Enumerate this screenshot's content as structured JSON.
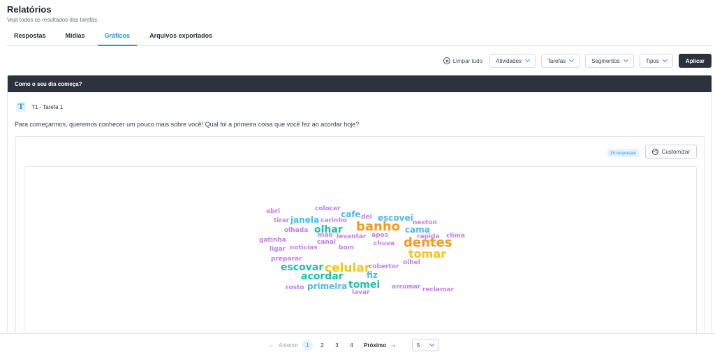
{
  "header": {
    "title": "Relatórios",
    "subtitle": "Veja todos os resultados das tarefas."
  },
  "tabs": [
    {
      "label": "Respostas",
      "active": false
    },
    {
      "label": "Mídias",
      "active": false
    },
    {
      "label": "Gráficos",
      "active": true
    },
    {
      "label": "Arquivos exportados",
      "active": false
    }
  ],
  "filters": {
    "clear_label": "Limpar tudo",
    "atividades": "Atividades",
    "tarefas": "Tarefas",
    "segmentos": "Segmentos",
    "tipos": "Tipos",
    "apply_label": "Aplicar"
  },
  "card": {
    "title": "Como o seu dia começa?",
    "task_icon_letter": "T",
    "task_label": "T1 - Tarefa 1",
    "question": "Para começarmos, queremos conhecer um pouco mais sobre você! Qual foi a primeira coisa que você fez ao acordar hoje?",
    "responses_badge": "15 respostas",
    "customize_label": "Customizar"
  },
  "colors": {
    "accent": "#1e96e9",
    "dark": "#2c313b",
    "purple": "#c27ef0",
    "blue": "#4fb8ef",
    "teal": "#16c4a6",
    "orange": "#f49b1c",
    "yellow": "#f7c321"
  },
  "wordcloud": {
    "words": [
      {
        "text": "abri",
        "color": "purple"
      },
      {
        "text": "colocar",
        "color": "purple"
      },
      {
        "text": "cafe",
        "color": "blue"
      },
      {
        "text": "tirar",
        "color": "purple"
      },
      {
        "text": "janela",
        "color": "blue"
      },
      {
        "text": "carinho",
        "color": "purple"
      },
      {
        "text": "dei",
        "color": "purple"
      },
      {
        "text": "escovei",
        "color": "blue"
      },
      {
        "text": "neston",
        "color": "purple"
      },
      {
        "text": "olhada",
        "color": "purple"
      },
      {
        "text": "olhar",
        "color": "teal"
      },
      {
        "text": "banho",
        "color": "orange"
      },
      {
        "text": "cama",
        "color": "blue"
      },
      {
        "text": "mae",
        "color": "purple"
      },
      {
        "text": "levantar",
        "color": "purple"
      },
      {
        "text": "apos",
        "color": "purple"
      },
      {
        "text": "rapida",
        "color": "purple"
      },
      {
        "text": "clima",
        "color": "purple"
      },
      {
        "text": "gatinha",
        "color": "purple"
      },
      {
        "text": "canal",
        "color": "purple"
      },
      {
        "text": "chuva",
        "color": "purple"
      },
      {
        "text": "dentes",
        "color": "orange"
      },
      {
        "text": "ligar",
        "color": "purple"
      },
      {
        "text": "noticias",
        "color": "purple"
      },
      {
        "text": "bom",
        "color": "purple"
      },
      {
        "text": "tomar",
        "color": "yellow"
      },
      {
        "text": "preparar",
        "color": "purple"
      },
      {
        "text": "olhei",
        "color": "purple"
      },
      {
        "text": "escovar",
        "color": "teal"
      },
      {
        "text": "celular",
        "color": "yellow"
      },
      {
        "text": "cobertor",
        "color": "purple"
      },
      {
        "text": "acordar",
        "color": "teal"
      },
      {
        "text": "fiz",
        "color": "blue"
      },
      {
        "text": "rosto",
        "color": "purple"
      },
      {
        "text": "primeira",
        "color": "blue"
      },
      {
        "text": "tomei",
        "color": "teal"
      },
      {
        "text": "arrumar",
        "color": "purple"
      },
      {
        "text": "reclamar",
        "color": "purple"
      },
      {
        "text": "lavar",
        "color": "purple"
      }
    ]
  },
  "pagination": {
    "prev_label": "Anterior",
    "pages": [
      "1",
      "2",
      "3",
      "4"
    ],
    "current": "1",
    "next_label": "Próximo",
    "per_page": "5"
  }
}
